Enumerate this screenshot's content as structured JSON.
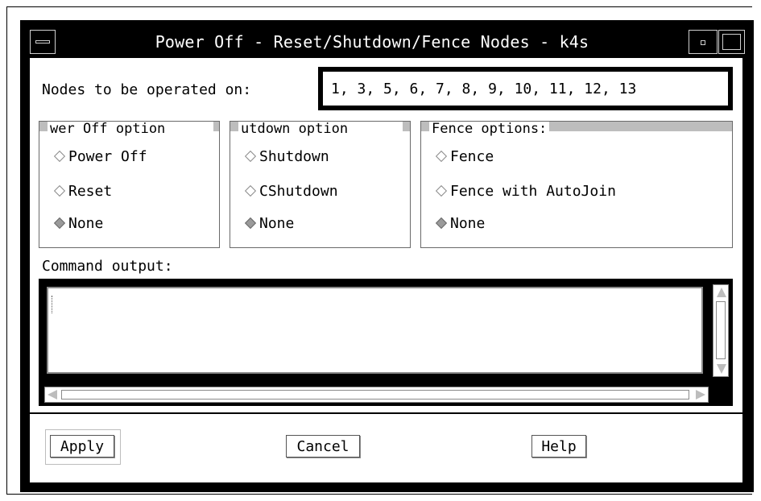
{
  "window": {
    "title": "Power Off - Reset/Shutdown/Fence Nodes - k4s"
  },
  "nodes": {
    "label": "Nodes to be operated on:",
    "value": "1, 3, 5, 6, 7, 8, 9, 10, 11, 12, 13"
  },
  "groups": {
    "power": {
      "title": "wer Off option",
      "options": [
        "Power Off",
        "Reset",
        "None"
      ],
      "selected": "None"
    },
    "shutdown": {
      "title": "utdown option",
      "options": [
        "Shutdown",
        "CShutdown",
        "None"
      ],
      "selected": "None"
    },
    "fence": {
      "title": "Fence options:",
      "options": [
        "Fence",
        "Fence with AutoJoin",
        "None"
      ],
      "selected": "None"
    }
  },
  "output": {
    "label": "Command output:",
    "text": ""
  },
  "buttons": {
    "apply": "Apply",
    "cancel": "Cancel",
    "help": "Help"
  },
  "icons": [
    "window-menu-icon",
    "minimize-icon",
    "maximize-icon",
    "scroll-up-arrow-icon",
    "scroll-down-arrow-icon",
    "scroll-left-arrow-icon",
    "scroll-right-arrow-icon"
  ],
  "colors": {
    "frame": "#000000",
    "background": "#ffffff",
    "group_header": "#bdbdbd",
    "selected_radio": "#9a9a9a"
  }
}
